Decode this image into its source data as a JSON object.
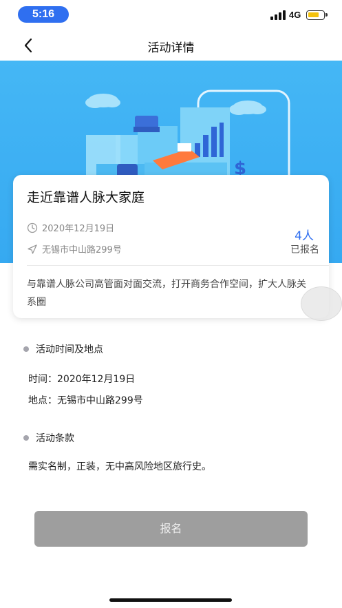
{
  "status_bar": {
    "time": "5:16",
    "network": "4G"
  },
  "nav": {
    "title": "活动详情"
  },
  "event": {
    "title": "走近靠谱人脉大家庭",
    "date": "2020年12月19日",
    "address": "无锡市中山路299号",
    "signup_count": "4人",
    "signup_label": "已报名",
    "description": "与靠谱人脉公司高管面对面交流，打开商务合作空间，扩大人脉关系圈"
  },
  "time_place": {
    "heading": "活动时间及地点",
    "time_line": "时间：2020年12月19日",
    "place_line": "地点：无锡市中山路299号"
  },
  "terms": {
    "heading": "活动条款",
    "text": "需实名制，正装，无中高风险地区旅行史。"
  },
  "signup_button": "报名",
  "colors": {
    "accent": "#2f6ff0",
    "hero_blue": "#3fb1f3",
    "button_gray": "#9e9e9e"
  }
}
